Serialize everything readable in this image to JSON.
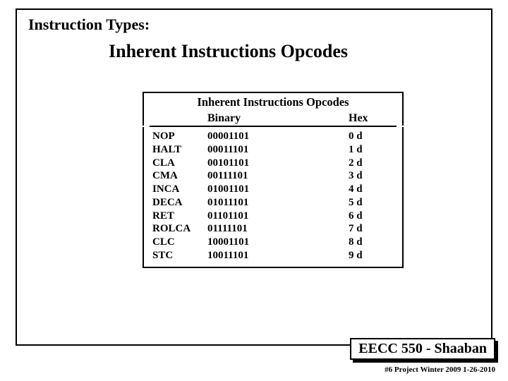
{
  "section_title": "Instruction Types:",
  "main_title": "Inherent  Instructions Opcodes",
  "table": {
    "title": "Inherent  Instructions Opcodes",
    "headers": {
      "binary": "Binary",
      "hex": "Hex"
    },
    "rows": [
      {
        "mn": "NOP",
        "bin": "00001101",
        "hex": "0 d"
      },
      {
        "mn": "HALT",
        "bin": "00011101",
        "hex": "1 d"
      },
      {
        "mn": "CLA",
        "bin": "00101101",
        "hex": "2 d"
      },
      {
        "mn": "CMA",
        "bin": "00111101",
        "hex": "3 d"
      },
      {
        "mn": "INCA",
        "bin": "01001101",
        "hex": "4 d"
      },
      {
        "mn": "DECA",
        "bin": "01011101",
        "hex": "5 d"
      },
      {
        "mn": "RET",
        "bin": "01101101",
        "hex": "6 d"
      },
      {
        "mn": "ROLCA",
        "bin": "01111101",
        "hex": "7 d"
      },
      {
        "mn": "CLC",
        "bin": "10001101",
        "hex": "8 d"
      },
      {
        "mn": "STC",
        "bin": "10011101",
        "hex": "9 d"
      }
    ]
  },
  "footer": {
    "badge": "EECC 550 - Shaaban",
    "line": "#6   Project  Winter 2009   1-26-2010"
  }
}
